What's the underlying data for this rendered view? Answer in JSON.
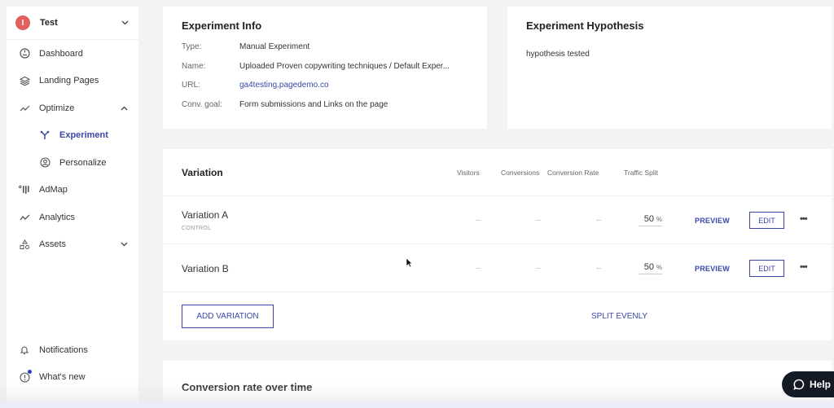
{
  "sidebar": {
    "workspace": {
      "initial": "I",
      "name": "Test",
      "avatar_color": "#e26060"
    },
    "items": [
      {
        "label": "Dashboard",
        "icon": "dashboard-icon"
      },
      {
        "label": "Landing Pages",
        "icon": "layers-icon"
      },
      {
        "label": "Optimize",
        "icon": "trend-icon",
        "expanded": true
      },
      {
        "label": "Experiment",
        "icon": "experiment-icon",
        "active": true,
        "sub": true
      },
      {
        "label": "Personalize",
        "icon": "person-circle-icon",
        "sub": true
      },
      {
        "label": "AdMap",
        "icon": "admap-icon"
      },
      {
        "label": "Analytics",
        "icon": "analytics-icon"
      },
      {
        "label": "Assets",
        "icon": "assets-icon",
        "expanded": false
      }
    ],
    "bottom": [
      {
        "label": "Notifications",
        "icon": "bell-icon"
      },
      {
        "label": "What's new",
        "icon": "info-icon",
        "badge": true
      }
    ]
  },
  "experiment_info": {
    "title": "Experiment Info",
    "rows": [
      {
        "label": "Type:",
        "value": "Manual Experiment"
      },
      {
        "label": "Name:",
        "value": "Uploaded Proven copywriting techniques / Default Exper..."
      },
      {
        "label": "URL:",
        "value": "ga4testing.pagedemo.co"
      },
      {
        "label": "Conv. goal:",
        "value": "Form submissions and Links on the page"
      }
    ]
  },
  "hypothesis": {
    "title": "Experiment Hypothesis",
    "text": "hypothesis tested"
  },
  "variations": {
    "title": "Variation",
    "columns": [
      "Visitors",
      "Conversions",
      "Conversion Rate",
      "Traffic Split"
    ],
    "rows": [
      {
        "name": "Variation A",
        "tag": "CONTROL",
        "visitors": "--",
        "conversions": "--",
        "rate": "--",
        "split": "50",
        "split_unit": "%",
        "preview": "PREVIEW",
        "edit": "EDIT",
        "more": "•••"
      },
      {
        "name": "Variation B",
        "tag": "",
        "visitors": "--",
        "conversions": "--",
        "rate": "--",
        "split": "50",
        "split_unit": "%",
        "preview": "PREVIEW",
        "edit": "EDIT",
        "more": "•••"
      }
    ],
    "add_label": "ADD VARIATION",
    "split_evenly_label": "SPLIT EVENLY"
  },
  "conversion_chart": {
    "title": "Conversion rate over time"
  },
  "help": {
    "label": "Help"
  },
  "colors": {
    "accent": "#3a47a8",
    "badge": "#2a3ec8",
    "help_bg": "#141a24"
  }
}
